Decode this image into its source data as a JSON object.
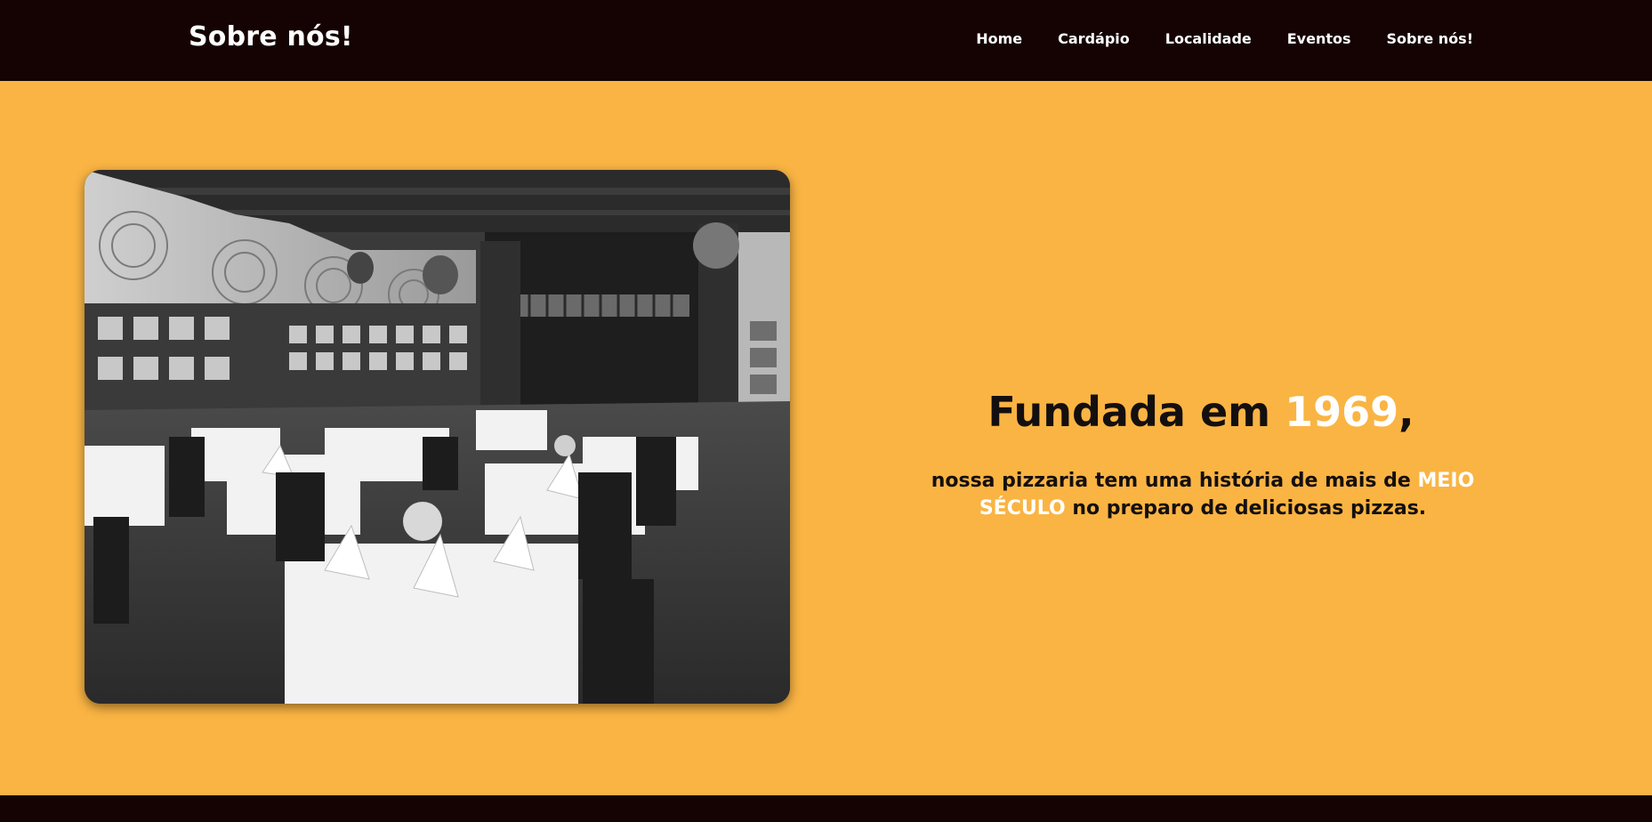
{
  "header": {
    "brand": "Sobre nós!",
    "nav": [
      "Home",
      "Cardápio",
      "Localidade",
      "Eventos",
      "Sobre nós!"
    ]
  },
  "hero": {
    "headline_prefix": "Fundada em ",
    "headline_year": "1969",
    "headline_suffix": ",",
    "text_before": "nossa pizzaria tem uma história de mais de ",
    "text_highlight": "MEIO SÉCULO",
    "text_after": " no preparo de deliciosas pizzas."
  },
  "colors": {
    "header_bg": "#150303",
    "page_bg": "#fab443",
    "text": "#140f0f",
    "highlight": "#ffffff"
  }
}
